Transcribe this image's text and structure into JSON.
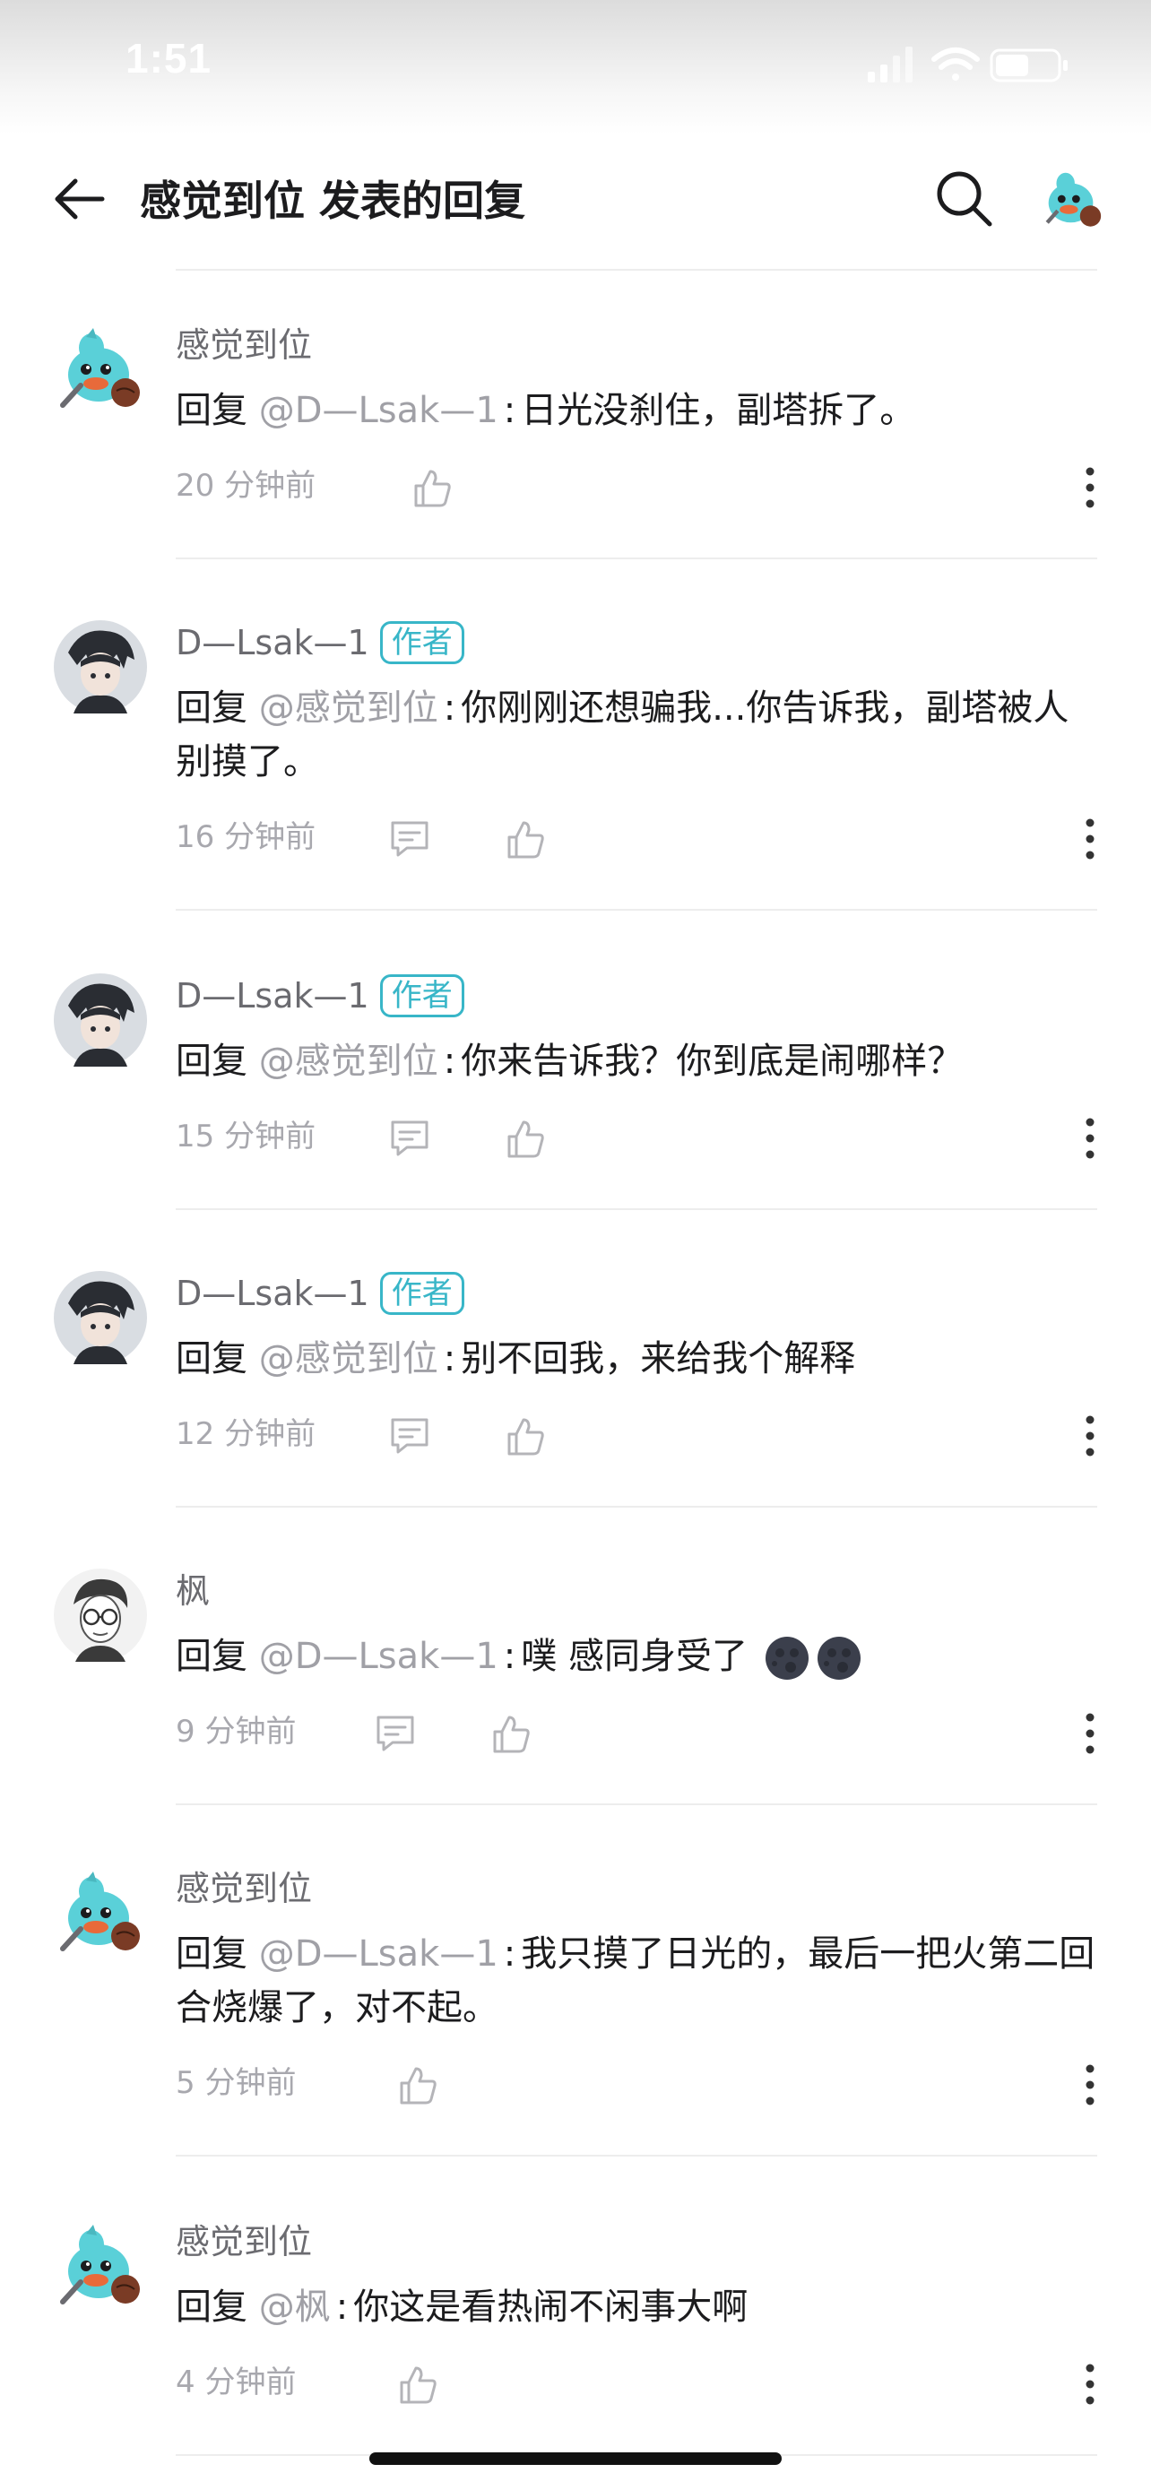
{
  "status_bar": {
    "time": "1:51"
  },
  "header": {
    "title": "感觉到位 发表的回复"
  },
  "replies": [
    {
      "author": "感觉到位",
      "badge": "",
      "prefix": "回复",
      "mention": "@D—Lsak—1",
      "colon": ":",
      "text": "日光没刹住，副塔拆了。",
      "time": "20 分钟前",
      "avatar": "blue-bird"
    },
    {
      "author": "D—Lsak—1",
      "badge": "作者",
      "prefix": "回复",
      "mention": "@感觉到位",
      "colon": ":",
      "text": "你刚刚还想骗我...你告诉我，副塔被人别摸了。",
      "time": "16 分钟前",
      "avatar": "anime-boy"
    },
    {
      "author": "D—Lsak—1",
      "badge": "作者",
      "prefix": "回复",
      "mention": "@感觉到位",
      "colon": ":",
      "text": "你来告诉我？你到底是闹哪样？",
      "time": "15 分钟前",
      "avatar": "anime-boy"
    },
    {
      "author": "D—Lsak—1",
      "badge": "作者",
      "prefix": "回复",
      "mention": "@感觉到位",
      "colon": ":",
      "text": "别不回我，来给我个解释",
      "time": "12 分钟前",
      "avatar": "anime-boy"
    },
    {
      "author": "枫",
      "badge": "",
      "prefix": "回复",
      "mention": "@D—Lsak—1",
      "colon": ":",
      "text": "噗 感同身受了",
      "emoji": "new-moon-face new-moon-face",
      "time": "9 分钟前",
      "avatar": "glasses-man"
    },
    {
      "author": "感觉到位",
      "badge": "",
      "prefix": "回复",
      "mention": "@D—Lsak—1",
      "colon": ":",
      "text": "我只摸了日光的，最后一把火第二回合烧爆了，对不起。",
      "time": "5 分钟前",
      "avatar": "blue-bird"
    },
    {
      "author": "感觉到位",
      "badge": "",
      "prefix": "回复",
      "mention": "@枫",
      "colon": ":",
      "text": "你这是看热闹不闲事大啊",
      "time": "4 分钟前",
      "avatar": "blue-bird"
    }
  ],
  "icons": {
    "back": "arrow-left-icon",
    "search": "search-icon",
    "comment": "comment-icon",
    "like": "thumbs-up-icon",
    "more": "more-vertical-icon"
  },
  "colors": {
    "accent": "#38b6c8",
    "mention": "#a0a0a6",
    "meta": "#a8a8ae"
  }
}
